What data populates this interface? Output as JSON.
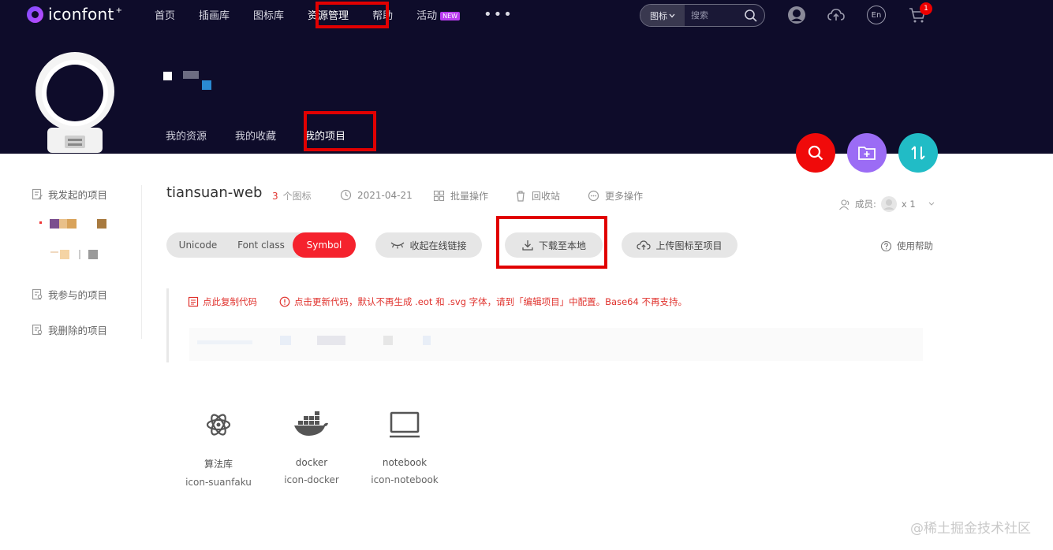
{
  "header": {
    "logo_text": "iconfont",
    "logo_star": "+",
    "nav": [
      {
        "label": "首页"
      },
      {
        "label": "插画库"
      },
      {
        "label": "图标库"
      },
      {
        "label": "资源管理"
      },
      {
        "label": "帮助"
      },
      {
        "label": "活动",
        "badge": "NEW"
      }
    ],
    "more": "•••",
    "search": {
      "type_label": "图标",
      "placeholder": "搜索"
    },
    "cart_count": "1",
    "lang_label": "En"
  },
  "profile": {
    "subtabs": [
      "我的资源",
      "我的收藏",
      "我的项目"
    ]
  },
  "sidebar": {
    "items": [
      "我发起的项目",
      "我参与的项目",
      "我删除的项目"
    ]
  },
  "project": {
    "title": "tiansuan-web",
    "count": "3",
    "count_suffix": "个图标",
    "date": "2021-04-21",
    "batch": "批量操作",
    "recycle": "回收站",
    "more": "更多操作",
    "members_label": "成员:",
    "members_count": "x 1"
  },
  "toolbar": {
    "tabs": [
      "Unicode",
      "Font class",
      "Symbol"
    ],
    "active_tab": "Symbol",
    "collapse_link": "收起在线链接",
    "download": "下载至本地",
    "upload": "上传图标至项目",
    "help": "使用帮助"
  },
  "code_panel": {
    "copy": "点此复制代码",
    "update": "点击更新代码，默认不再生成 .eot 和 .svg 字体，请到「编辑项目」中配置。Base64 不再支持。"
  },
  "icons": [
    {
      "name": "算法库",
      "code": "icon-suanfaku",
      "icon": "atom-icon"
    },
    {
      "name": "docker",
      "code": "icon-docker",
      "icon": "docker-icon"
    },
    {
      "name": "notebook",
      "code": "icon-notebook",
      "icon": "notebook-icon"
    }
  ],
  "watermark": "@稀土掘金技术社区",
  "colors": {
    "header_bg": "#0e0c2a",
    "accent_red": "#f5222d",
    "fab_search": "#f00a0a",
    "fab_folder": "#9b6cf5",
    "fab_sort": "#21bcc6",
    "annotation_red": "#e10000"
  }
}
